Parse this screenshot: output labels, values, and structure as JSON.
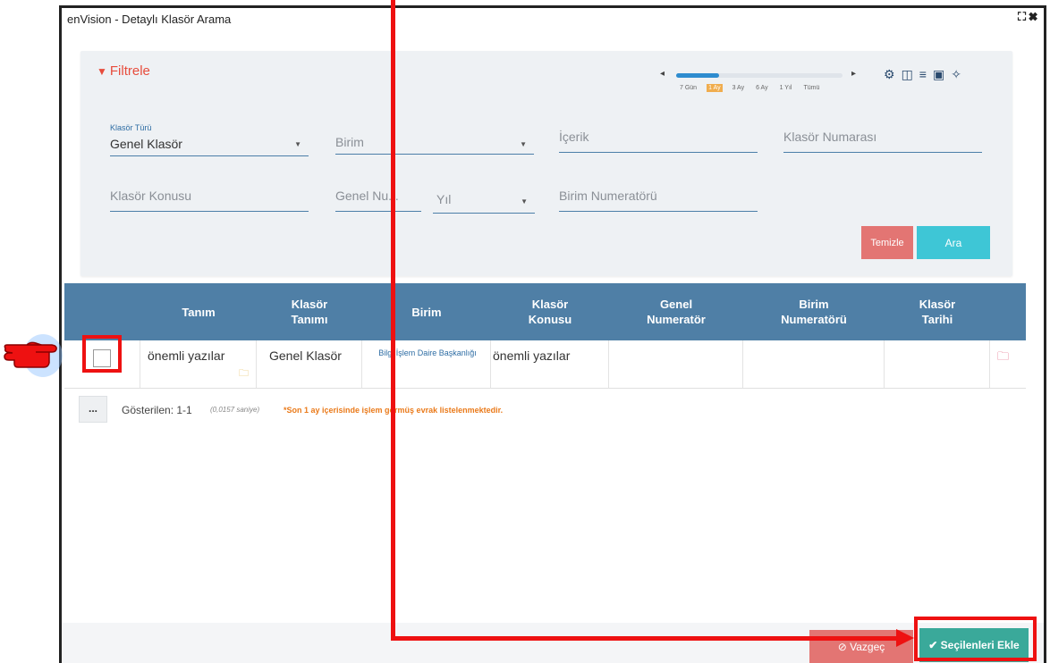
{
  "window": {
    "title": "enVision - Detaylı Klasör Arama",
    "icons": [
      "expand-icon",
      "close-icon"
    ]
  },
  "filter": {
    "title": "Filtrele",
    "time_ranges": [
      "7 Gün",
      "1 Ay",
      "3 Ay",
      "6 Ay",
      "1 Yıl",
      "Tümü"
    ],
    "selected_range": "1 Ay",
    "fields": {
      "klasor_turu": {
        "label": "Klasör Türü",
        "value": "Genel Klasör"
      },
      "birim": {
        "placeholder": "Birim"
      },
      "icerik": {
        "placeholder": "İçerik"
      },
      "klasor_numarasi": {
        "placeholder": "Klasör Numarası"
      },
      "klasor_konusu": {
        "placeholder": "Klasör Konusu"
      },
      "genel_nu": {
        "placeholder": "Genel Nu..."
      },
      "yil": {
        "placeholder": "Yıl"
      },
      "birim_numeratoru": {
        "placeholder": "Birim Numeratörü"
      }
    },
    "clear_label": "Temizle",
    "search_label": "Ara"
  },
  "table": {
    "headers": [
      "Tanım",
      "Klasör Tanımı",
      "Birim",
      "Klasör Konusu",
      "Genel Numeratör",
      "Birim Numeratörü",
      "Klasör Tarihi"
    ],
    "rows": [
      {
        "tanim": "önemli yazılar",
        "klasor_tanimi": "Genel Klasör",
        "birim": "Bilgi İşlem Daire Başkanlığı",
        "klasor_konusu": "önemli yazılar",
        "genel_numerator": "",
        "birim_numeratoru": "",
        "klasor_tarihi": ""
      }
    ]
  },
  "footer": {
    "more_label": "...",
    "shown": "Gösterilen: 1-1",
    "timing": "(0,0157 saniye)",
    "note": "*Son 1 ay içerisinde işlem görmüş evrak listelenmektedir."
  },
  "actions": {
    "cancel_label": "Vazgeç",
    "select_label": "Seçilenleri Ekle"
  },
  "colors": {
    "header": "#4f7fa6",
    "accent_red": "#e37573",
    "accent_teal": "#3aa99a",
    "annotation": "#ee1111"
  }
}
